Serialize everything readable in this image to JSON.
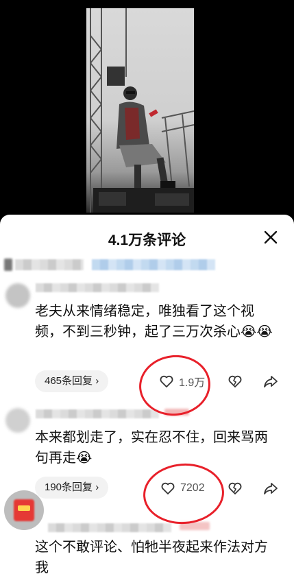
{
  "comment_count_title": "4.1万条评论",
  "comments": [
    {
      "text": "老夫从来情绪稳定，唯独看了这个视频，不到三秒钟，起了三万次杀心😭😭",
      "replies": "465条回复 ›",
      "likes": "1.9万"
    },
    {
      "text": "本来都划走了，实在忍不住，回来骂两句再走😭",
      "replies": "190条回复 ›",
      "likes": "7202"
    },
    {
      "text": "这个不敢评论、怕牠半夜起来作法对方我"
    }
  ],
  "icons": {
    "close": "close-icon",
    "like": "heart-outline-icon",
    "dislike": "broken-heart-icon",
    "share": "share-arrow-icon"
  },
  "colors": {
    "annotation_red": "#e8202a",
    "sheet_bg": "#ffffff",
    "pill_bg": "#f2f2f2"
  }
}
